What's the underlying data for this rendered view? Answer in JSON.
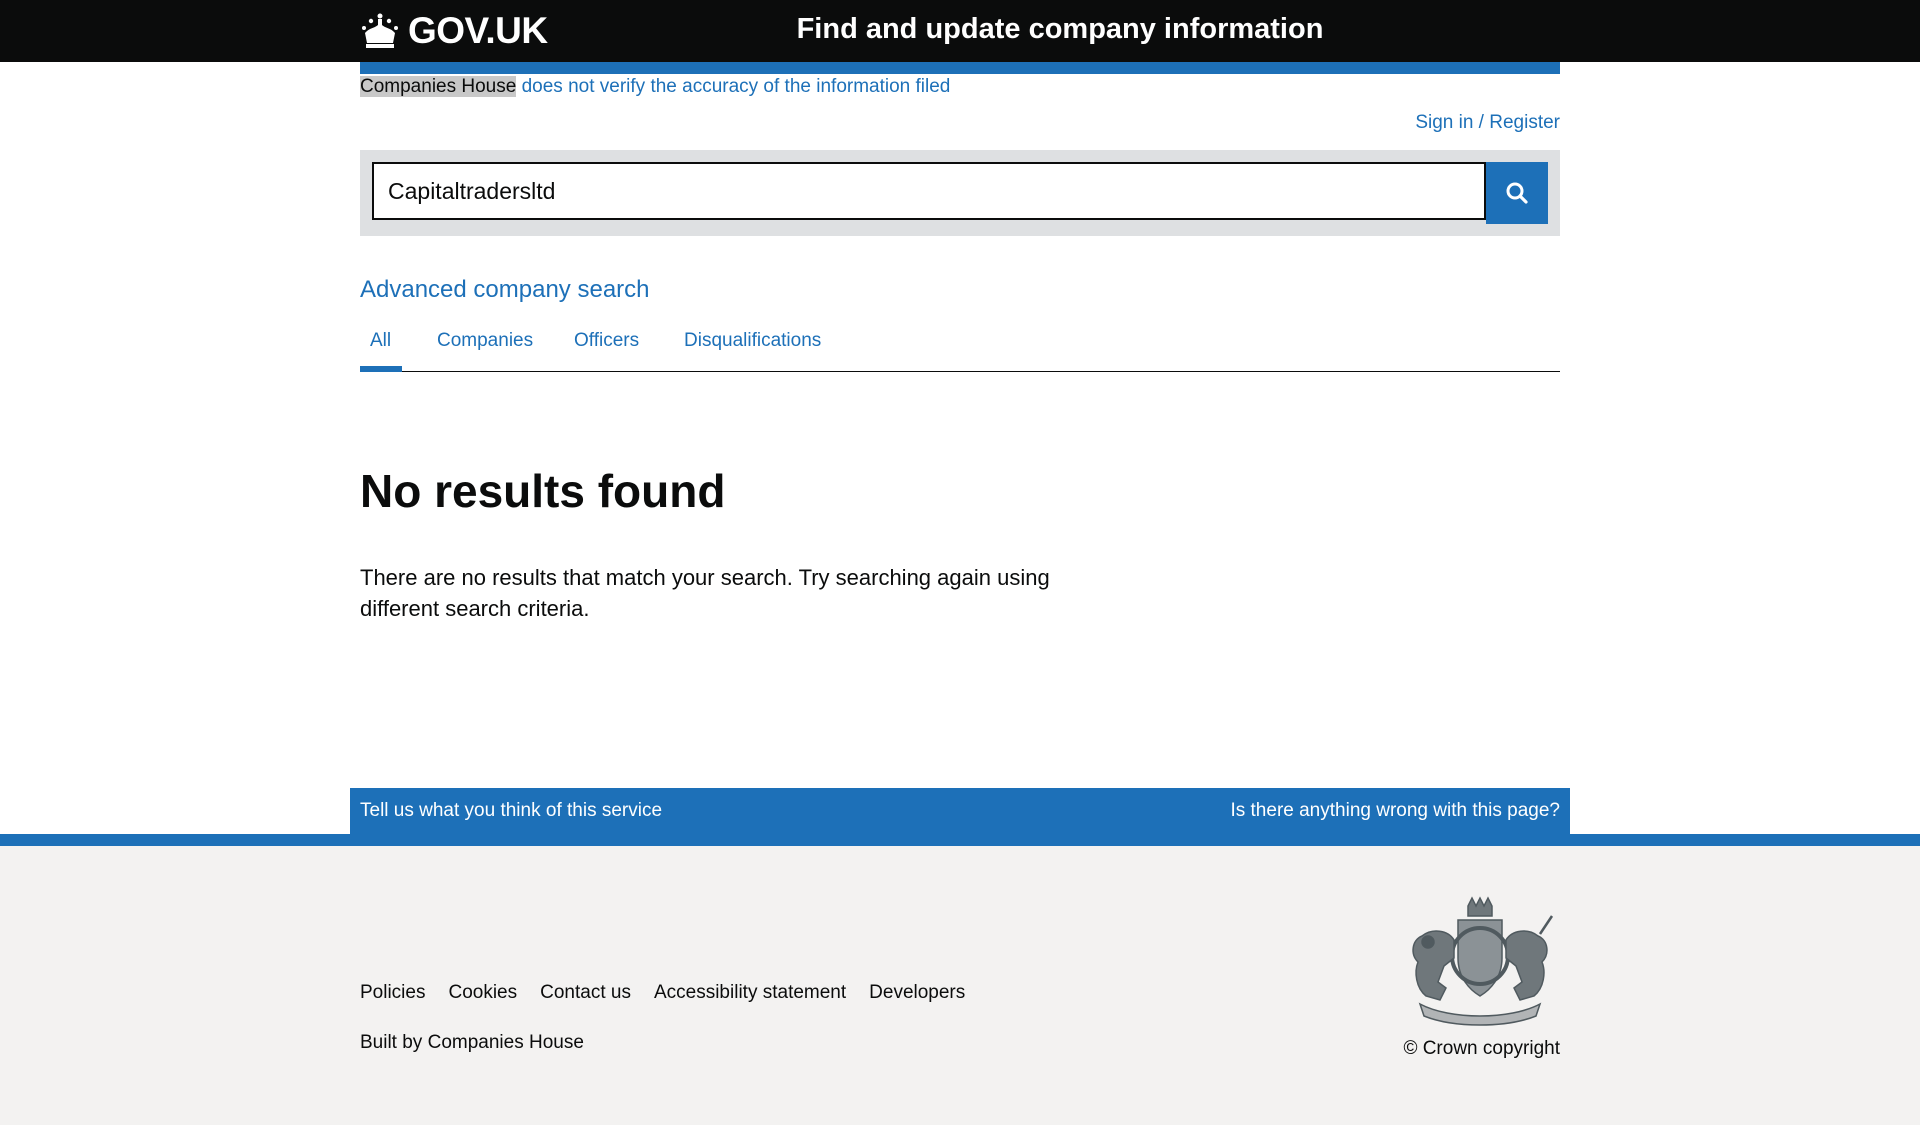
{
  "header": {
    "logo_text": "GOV.UK",
    "service_name": "Find and update company information"
  },
  "notice": {
    "highlight": "Companies House",
    "rest": "does not verify the accuracy of the information filed"
  },
  "account": {
    "signin_label": "Sign in / Register"
  },
  "search": {
    "value": "Capitaltradersltd",
    "button_icon": "search-icon"
  },
  "advanced_search_label": "Advanced company search",
  "tabs": [
    {
      "label": "All",
      "active": true
    },
    {
      "label": "Companies"
    },
    {
      "label": "Officers"
    },
    {
      "label": "Disqualifications"
    }
  ],
  "main": {
    "title": "No results found",
    "body": "There are no results that match your search. Try searching again using different search criteria."
  },
  "feedback": {
    "left": "Tell us what you think of this service",
    "right": "Is there anything wrong with this page?"
  },
  "footer": {
    "links": [
      "Policies",
      "Cookies",
      "Contact us",
      "Accessibility statement",
      "Developers"
    ],
    "built_by_prefix": "Built by",
    "built_by_link": "Companies House",
    "copyright": "© Crown copyright",
    "crest_icon": "royal-coat-of-arms-icon"
  },
  "colors": {
    "header_bg": "#0b0c0c",
    "brand_blue": "#1d70b8",
    "footer_bg": "#f3f2f1",
    "search_bg": "#dee0e2"
  }
}
